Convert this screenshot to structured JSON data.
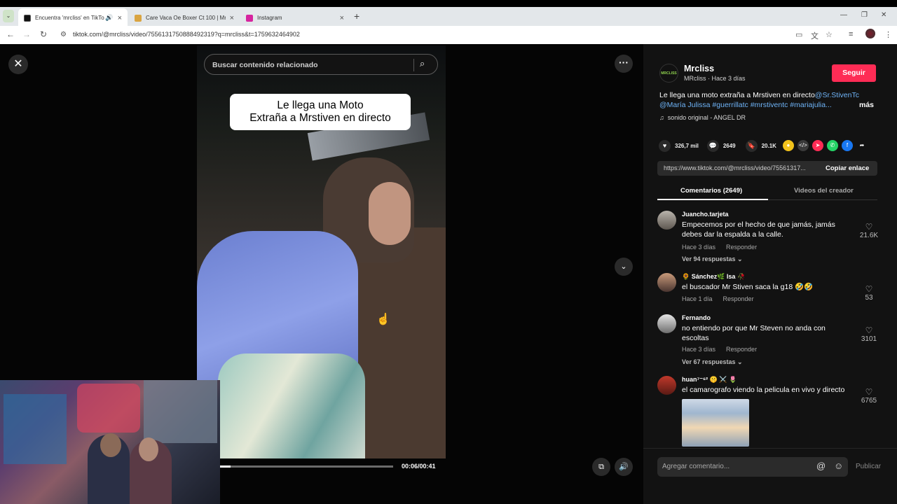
{
  "browser": {
    "tabs": [
      {
        "title": "Encuentra 'mrcliss' en TikTo",
        "icon_color": "#111111",
        "active": true
      },
      {
        "title": "Care Vaca Oe Boxer Ct 100 | Mr",
        "icon_color": "#d9a441",
        "active": false
      },
      {
        "title": "Instagram",
        "icon_color": "#d6249f",
        "active": false
      }
    ],
    "url": "tiktok.com/@mrcliss/video/7556131750888492319?q=mrcliss&t=1759632464902"
  },
  "video": {
    "search_placeholder": "Buscar contenido relacionado",
    "caption_line1": "Le llega una Moto",
    "caption_line2": "Extraña a Mrstiven en directo",
    "progress": 0.06,
    "timecode": "00:06/00:41"
  },
  "author": {
    "avatar_text": "MRCLISS",
    "name": "Mrcliss",
    "sub": "MRcliss · Hace 3 días",
    "follow_label": "Seguir"
  },
  "description": {
    "text": "Le llega una moto extraña a Mrstiven en directo",
    "mention1": "@Sr.StivenTc",
    "line2": "@María Julissa #guerrillatc #mrstiventc #mariajulia...",
    "more": "más",
    "sound": "sonido original - ANGEL DR"
  },
  "actions": {
    "likes": "326,7 mil",
    "comments": "2649",
    "saves": "20.1K"
  },
  "link": {
    "url": "https://www.tiktok.com/@mrcliss/video/75561317...",
    "copy_label": "Copiar enlace"
  },
  "tabs": {
    "comments": "Comentarios (2649)",
    "creator_videos": "Videos del creador"
  },
  "comments": [
    {
      "user": "Juancho.tarjeta",
      "text": "Empecemos por el hecho de que jamás, jamás debes dar la espalda a la calle.",
      "time": "Hace 3 días",
      "reply": "Responder",
      "replies": "Ver 94 respuestas ⌄",
      "likes": "21.6K"
    },
    {
      "user": "🌻 Sánchez🌿 Isa 🥀",
      "text": "el buscador Mr Stiven saca la g18 🤣🤣",
      "time": "Hace 1 día",
      "reply": "Responder",
      "likes": "53"
    },
    {
      "user": "Fernando",
      "text": "no entiendo por que Mr Steven no anda con escoltas",
      "time": "Hace 3 días",
      "reply": "Responder",
      "replies": "Ver 67 respuestas ⌄",
      "likes": "3101"
    },
    {
      "user": "huan⁷⁻⁶² 🤫 ⚔️ 🌷",
      "text": "el camarografo viendo la pelicula en vivo y directo",
      "likes": "6765"
    }
  ],
  "composer": {
    "placeholder": "Agregar comentario...",
    "publish": "Publicar"
  }
}
